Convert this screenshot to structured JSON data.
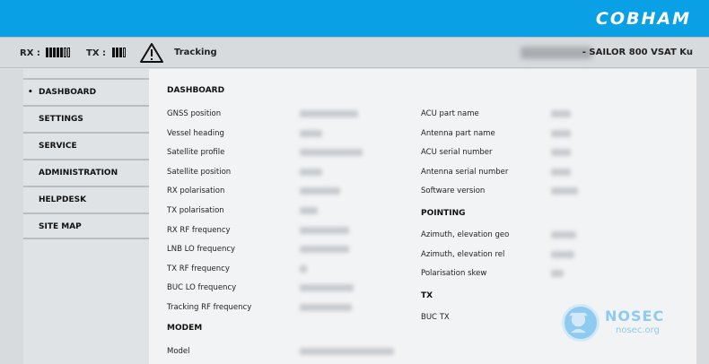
{
  "brand": {
    "logo": "COBHAM"
  },
  "status": {
    "rx_label": "RX :",
    "rx_bars": [
      1,
      1,
      1,
      1,
      1,
      0,
      0
    ],
    "tx_label": "TX :",
    "tx_bars": [
      1,
      1,
      1,
      0
    ],
    "warning_icon": "warning-triangle-icon",
    "tracking_text": "Tracking",
    "device_name": "- SAILOR 800 VSAT Ku"
  },
  "nav": {
    "items": [
      {
        "label": "DASHBOARD",
        "active": true,
        "bullet": "•"
      },
      {
        "label": "SETTINGS"
      },
      {
        "label": "SERVICE"
      },
      {
        "label": "ADMINISTRATION"
      },
      {
        "label": "HELPDESK"
      },
      {
        "label": "SITE MAP"
      }
    ]
  },
  "dashboard": {
    "title": "DASHBOARD",
    "left_fields": [
      "GNSS position",
      "Vessel heading",
      "Satellite profile",
      "Satellite position",
      "RX polarisation",
      "TX polarisation",
      "RX RF frequency",
      "LNB LO frequency",
      "TX RF frequency",
      "BUC LO frequency",
      "Tracking RF frequency"
    ],
    "modem_title": "MODEM",
    "modem_fields": [
      "Model"
    ],
    "right_fields": [
      "ACU part name",
      "Antenna part name",
      "ACU serial number",
      "Antenna serial number",
      "Software version"
    ],
    "pointing_title": "POINTING",
    "pointing_fields": [
      "Azimuth, elevation geo",
      "Azimuth, elevation rel",
      "Polarisation skew"
    ],
    "tx_title": "TX",
    "tx_fields": [
      "BUC TX"
    ]
  },
  "watermark": {
    "title": "NOSEC",
    "subtitle": "nosec.org"
  }
}
